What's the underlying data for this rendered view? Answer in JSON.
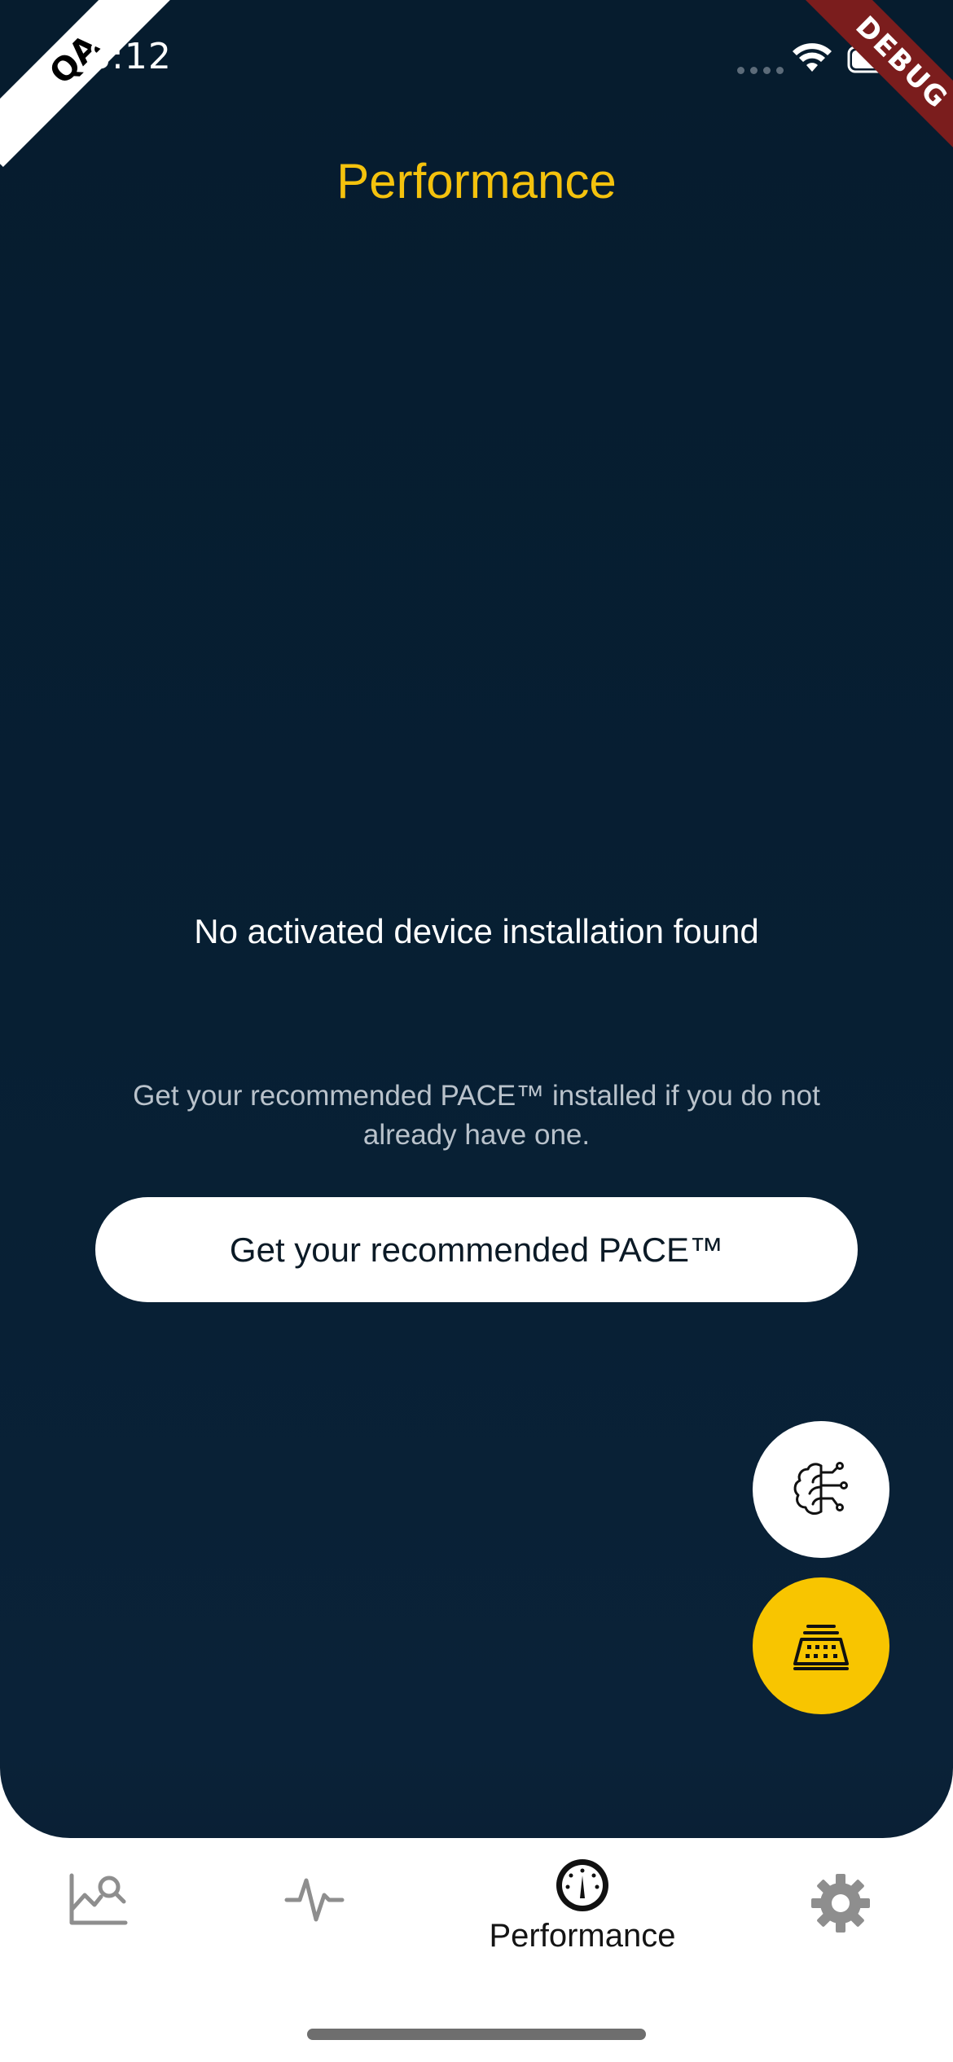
{
  "status_bar": {
    "time": "8:12",
    "qa_label": "QA",
    "debug_label": "DEBUG"
  },
  "page": {
    "title": "Performance"
  },
  "empty_state": {
    "title": "No activated device installation found",
    "description": "Get your recommended PACE™ installed if you do not already have one.",
    "button_label": "Get your recommended PACE™"
  },
  "fabs": [
    {
      "icon": "brain-circuit-icon"
    },
    {
      "icon": "device-install-icon"
    }
  ],
  "bottom_nav": {
    "items": [
      {
        "icon": "chart-search-icon",
        "label": ""
      },
      {
        "icon": "heartbeat-icon",
        "label": ""
      },
      {
        "icon": "speedometer-icon",
        "label": "Performance",
        "active": true
      },
      {
        "icon": "gear-icon",
        "label": ""
      }
    ]
  },
  "colors": {
    "background": "#061c2e",
    "accent": "#f4c20d",
    "fab_primary": "#f8c500",
    "debug_banner": "#7b1d1d",
    "nav_inactive": "#8e8e8e",
    "nav_active": "#141414"
  }
}
